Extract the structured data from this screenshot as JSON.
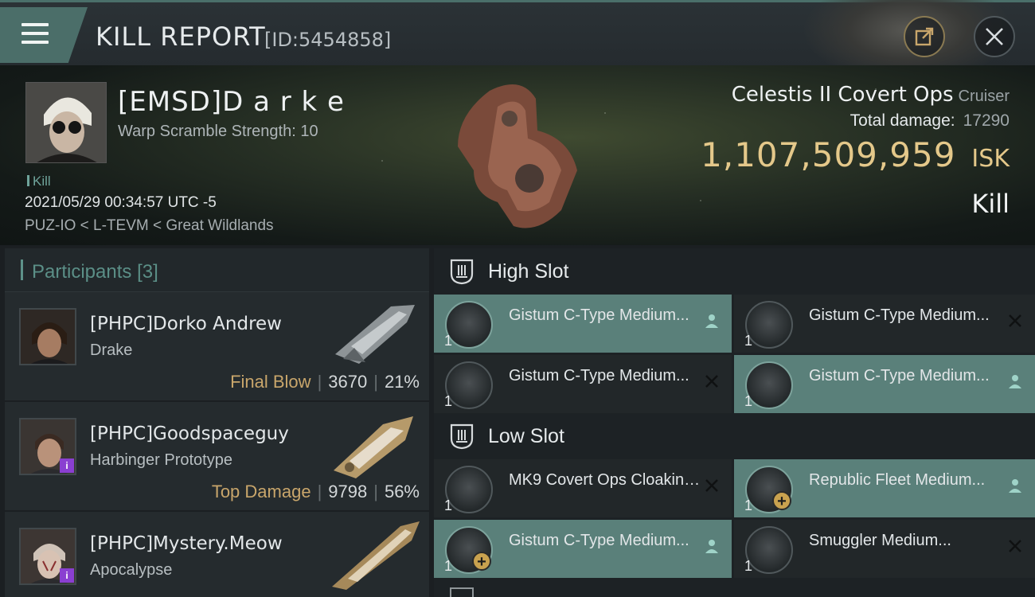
{
  "header": {
    "title": "KILL REPORT",
    "report_id": "[ID:5454858]",
    "menu_icon": "hamburger-icon",
    "share_icon": "share-icon",
    "close_icon": "close-icon"
  },
  "victim": {
    "name": "[EMSD]D a r k e",
    "warp_scramble": "Warp Scramble Strength: 10",
    "kill_tag": "Kill",
    "datetime": "2021/05/29 00:34:57 UTC -5",
    "location": "PUZ-IO < L-TEVM < Great Wildlands",
    "ship_name": "Celestis II Covert Ops",
    "ship_class": "Cruiser",
    "total_damage_label": "Total damage:",
    "total_damage": "17290",
    "isk_value": "1,107,509,959",
    "isk_unit": "ISK",
    "result": "Kill"
  },
  "participants": {
    "label": "Participants",
    "count": "[3]",
    "items": [
      {
        "name": "[PHPC]Dorko Andrew",
        "ship": "Drake",
        "tag": "Final Blow",
        "damage": "3670",
        "percent": "21%",
        "badge": ""
      },
      {
        "name": "[PHPC]Goodspaceguy",
        "ship": "Harbinger Prototype",
        "tag": "Top Damage",
        "damage": "9798",
        "percent": "56%",
        "badge": "i"
      },
      {
        "name": "[PHPC]Mystery.Meow",
        "ship": "Apocalypse",
        "tag": "",
        "damage": "",
        "percent": "",
        "badge": "i"
      }
    ]
  },
  "fitting": {
    "high_slot_label": "High Slot",
    "low_slot_label": "Low Slot",
    "high": [
      {
        "name": "Gistum C-Type Medium...",
        "qty": "1",
        "state": "dropped"
      },
      {
        "name": "Gistum C-Type Medium...",
        "qty": "1",
        "state": "destroyed"
      },
      {
        "name": "Gistum C-Type Medium...",
        "qty": "1",
        "state": "destroyed"
      },
      {
        "name": "Gistum C-Type Medium...",
        "qty": "1",
        "state": "dropped"
      }
    ],
    "low": [
      {
        "name": "MK9 Covert Ops Cloaking...",
        "qty": "1",
        "state": "destroyed"
      },
      {
        "name": "Republic Fleet Medium...",
        "qty": "1",
        "state": "dropped"
      },
      {
        "name": "Gistum C-Type Medium...",
        "qty": "1",
        "state": "dropped"
      },
      {
        "name": "Smuggler Medium...",
        "qty": "1",
        "state": "destroyed"
      }
    ]
  },
  "colors": {
    "accent_teal": "#5a807a",
    "isk_gold": "#e4c88a",
    "tag_gold": "#c9a66b"
  }
}
